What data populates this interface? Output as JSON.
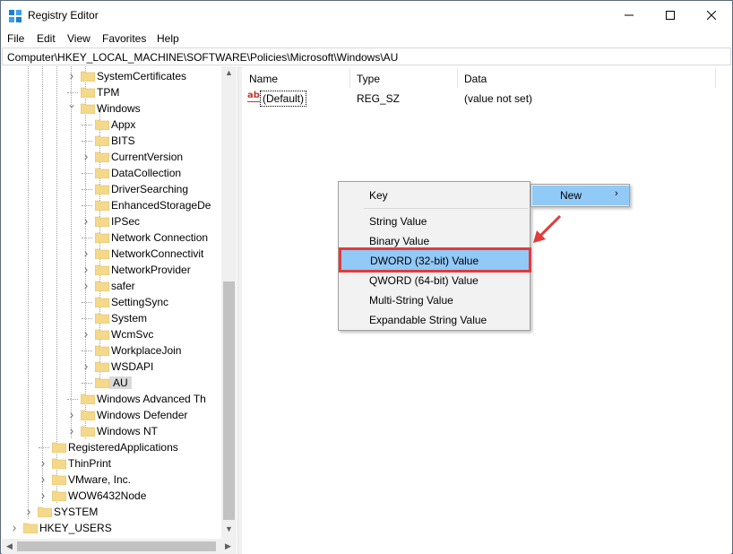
{
  "window": {
    "title": "Registry Editor"
  },
  "menu": [
    "File",
    "Edit",
    "View",
    "Favorites",
    "Help"
  ],
  "address": "Computer\\HKEY_LOCAL_MACHINE\\SOFTWARE\\Policies\\Microsoft\\Windows\\AU",
  "tree": {
    "items": [
      {
        "label": "SystemCertificates",
        "expander": "right"
      },
      {
        "label": "TPM",
        "expander": "none"
      },
      {
        "label": "Windows",
        "expander": "down"
      },
      {
        "label": "Appx",
        "expander": "none"
      },
      {
        "label": "BITS",
        "expander": "none"
      },
      {
        "label": "CurrentVersion",
        "expander": "right"
      },
      {
        "label": "DataCollection",
        "expander": "none"
      },
      {
        "label": "DriverSearching",
        "expander": "none"
      },
      {
        "label": "EnhancedStorageDe",
        "expander": "none"
      },
      {
        "label": "IPSec",
        "expander": "right"
      },
      {
        "label": "Network Connection",
        "expander": "none"
      },
      {
        "label": "NetworkConnectivit",
        "expander": "right"
      },
      {
        "label": "NetworkProvider",
        "expander": "right"
      },
      {
        "label": "safer",
        "expander": "right"
      },
      {
        "label": "SettingSync",
        "expander": "none"
      },
      {
        "label": "System",
        "expander": "none"
      },
      {
        "label": "WcmSvc",
        "expander": "right"
      },
      {
        "label": "WorkplaceJoin",
        "expander": "none"
      },
      {
        "label": "WSDAPI",
        "expander": "right"
      },
      {
        "label": "AU",
        "expander": "none",
        "selected": true
      },
      {
        "label": "Windows Advanced Th",
        "expander": "none"
      },
      {
        "label": "Windows Defender",
        "expander": "right"
      },
      {
        "label": "Windows NT",
        "expander": "right"
      },
      {
        "label": "RegisteredApplications",
        "expander": "none"
      },
      {
        "label": "ThinPrint",
        "expander": "right"
      },
      {
        "label": "VMware, Inc.",
        "expander": "right"
      },
      {
        "label": "WOW6432Node",
        "expander": "right"
      },
      {
        "label": "SYSTEM",
        "expander": "right"
      },
      {
        "label": "HKEY_USERS",
        "expander": "right"
      }
    ]
  },
  "list": {
    "columns": [
      "Name",
      "Type",
      "Data"
    ],
    "rows": [
      {
        "name": "(Default)",
        "type": "REG_SZ",
        "data": "(value not set)",
        "icon": "string-value-icon"
      }
    ]
  },
  "context_menu": {
    "items": [
      "Key",
      "String Value",
      "Binary Value",
      "DWORD (32-bit) Value",
      "QWORD (64-bit) Value",
      "Multi-String Value",
      "Expandable String Value"
    ],
    "highlighted": "DWORD (32-bit) Value",
    "parent": "New"
  },
  "colors": {
    "highlight": "#91c9f7",
    "annotation_red": "#e33a3a",
    "folder": "#f5d98a"
  }
}
